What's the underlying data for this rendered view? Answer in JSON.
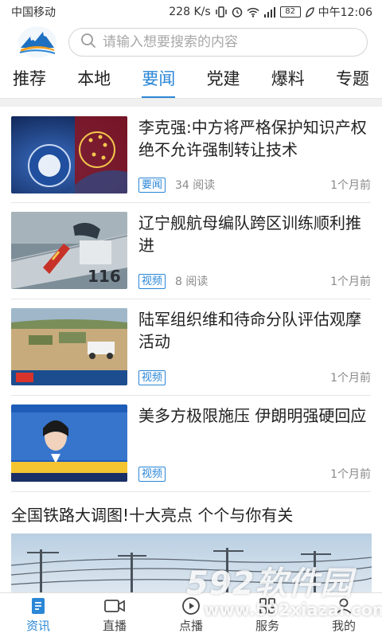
{
  "status_bar": {
    "carrier": "中国移动",
    "speed": "228 K/s",
    "battery": "82",
    "time": "中午12:06"
  },
  "search": {
    "placeholder": "请输入想要搜索的内容",
    "icon": "search-icon"
  },
  "tabs": [
    {
      "label": "推荐",
      "active": false
    },
    {
      "label": "本地",
      "active": false
    },
    {
      "label": "要闻",
      "active": true
    },
    {
      "label": "党建",
      "active": false
    },
    {
      "label": "爆料",
      "active": false
    },
    {
      "label": "专题",
      "active": false
    }
  ],
  "news": [
    {
      "title": "李克强:中方将严格保护知识产权 绝不允许强制转让技术",
      "tag": "要闻",
      "reads": "34 阅读",
      "time": "1个月前"
    },
    {
      "title": "辽宁舰航母编队跨区训练顺利推进",
      "tag": "视频",
      "reads": "8 阅读",
      "time": "1个月前"
    },
    {
      "title": "陆军组织维和待命分队评估观摩活动",
      "tag": "视频",
      "reads": "",
      "time": "1个月前"
    },
    {
      "title": "美多方极限施压 伊朗明强硬回应",
      "tag": "视频",
      "reads": "",
      "time": "1个月前"
    }
  ],
  "big_item": {
    "title": "全国铁路大调图!十大亮点 个个与你有关"
  },
  "bottom_nav": [
    {
      "label": "资讯",
      "icon": "document-icon",
      "active": true
    },
    {
      "label": "直播",
      "icon": "video-camera-icon",
      "active": false
    },
    {
      "label": "点播",
      "icon": "play-circle-icon",
      "active": false
    },
    {
      "label": "服务",
      "icon": "service-icon",
      "active": false
    },
    {
      "label": "我的",
      "icon": "user-icon",
      "active": false
    }
  ],
  "watermark": {
    "logo": "592软件园",
    "url": "www.592xiazai.com"
  },
  "colors": {
    "accent": "#2a86d6",
    "text": "#222222",
    "meta": "#8a8a8a"
  }
}
